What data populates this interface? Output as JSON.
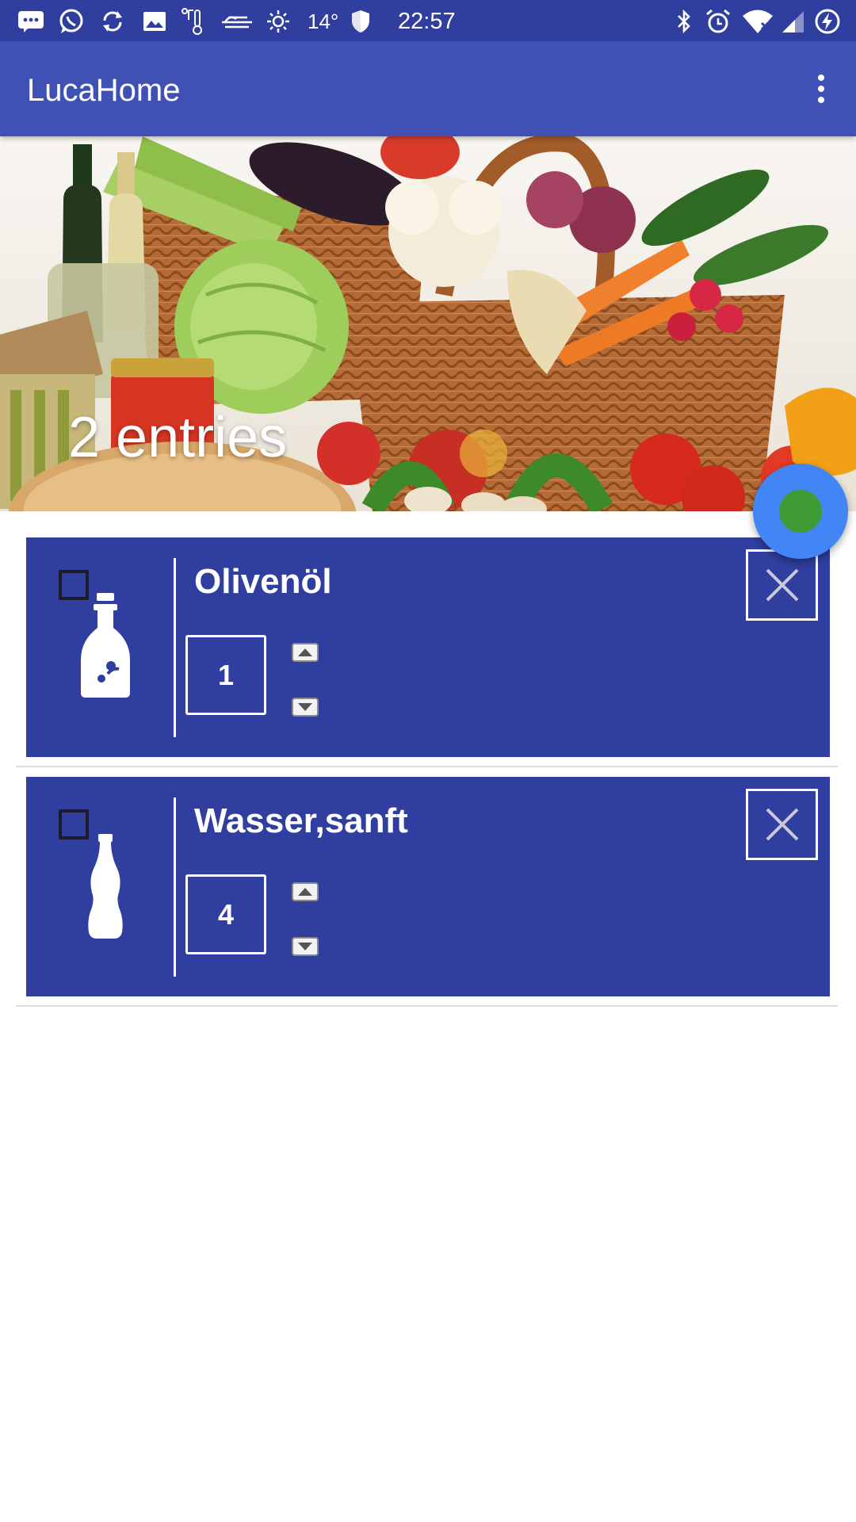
{
  "status_bar": {
    "temperature": "14°",
    "time": "22:57",
    "left_icons": [
      "message-icon",
      "whatsapp-icon",
      "sync-icon",
      "image-icon",
      "thermometer-icon",
      "weather-icon",
      "brightness-icon"
    ],
    "right_icons": [
      "bluetooth-icon",
      "alarm-icon",
      "wifi-icon",
      "signal-icon",
      "battery-charging-icon"
    ]
  },
  "app_bar": {
    "title": "LucaHome",
    "menu_icon": "more-vert-icon"
  },
  "header": {
    "entries_count": "2 entries",
    "image": "groceries-basket-image"
  },
  "fab": {
    "icon": "status-dot-icon",
    "color": "#4285f4",
    "dot_color": "#3f9c35"
  },
  "shopping_list": {
    "items": [
      {
        "name": "Olivenöl",
        "quantity": "1",
        "icon": "oil-bottle-icon",
        "checked": false
      },
      {
        "name": "Wasser,sanft",
        "quantity": "4",
        "icon": "water-bottle-icon",
        "checked": false
      }
    ]
  },
  "colors": {
    "status_bar": "#303f9f",
    "app_bar": "#3f51b5",
    "card": "#303f9f",
    "background": "#ffffff"
  }
}
